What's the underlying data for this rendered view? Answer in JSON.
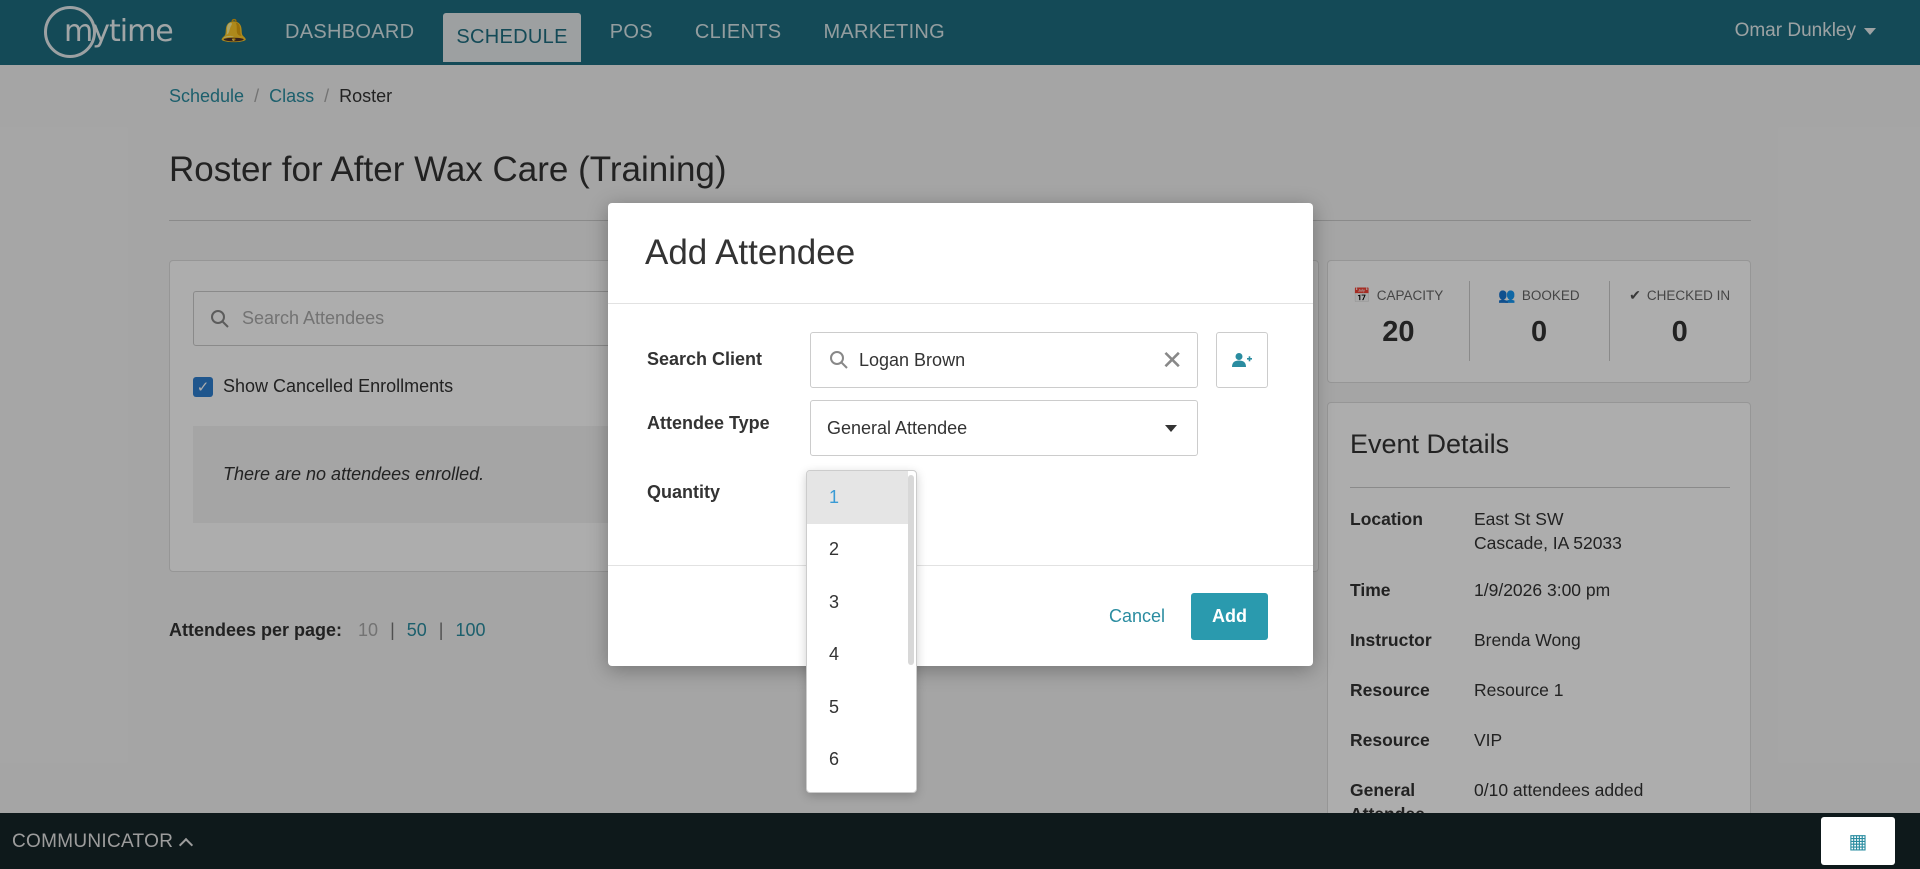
{
  "app": {
    "logo_text": "mytime"
  },
  "nav": {
    "items": [
      {
        "label": "DASHBOARD"
      },
      {
        "label": "SCHEDULE"
      },
      {
        "label": "POS"
      },
      {
        "label": "CLIENTS"
      },
      {
        "label": "MARKETING"
      }
    ],
    "active": "SCHEDULE",
    "user": "Omar Dunkley"
  },
  "breadcrumb": {
    "items": [
      "Schedule",
      "Class",
      "Roster"
    ],
    "separator": "/"
  },
  "page": {
    "title": "Roster for After Wax Care (Training)"
  },
  "roster": {
    "search_placeholder": "Search Attendees",
    "show_cancelled_label": "Show Cancelled Enrollments",
    "show_cancelled_checked": true,
    "empty_message": "There are no attendees enrolled.",
    "per_page_label": "Attendees per page:",
    "per_page_options": [
      "10",
      "50",
      "100"
    ],
    "per_page_current": "10"
  },
  "stats": {
    "capacity_label": "CAPACITY",
    "capacity_value": "20",
    "booked_label": "BOOKED",
    "booked_value": "0",
    "checked_in_label": "CHECKED IN",
    "checked_in_value": "0"
  },
  "event": {
    "title": "Event Details",
    "location_label": "Location",
    "location_line1": "East St SW",
    "location_line2": "Cascade, IA 52033",
    "time_label": "Time",
    "time_value": "1/9/2026 3:00 pm",
    "instructor_label": "Instructor",
    "instructor_value": "Brenda Wong",
    "resource1_label": "Resource",
    "resource1_value": "Resource 1",
    "resource2_label": "Resource",
    "resource2_value": "VIP",
    "limit_label": "General Attendee Limit",
    "limit_value": "0/10 attendees added"
  },
  "modal": {
    "title": "Add Attendee",
    "search_client_label": "Search Client",
    "search_client_value": "Logan Brown",
    "attendee_type_label": "Attendee Type",
    "attendee_type_value": "General Attendee",
    "quantity_label": "Quantity",
    "quantity_options": [
      "1",
      "2",
      "3",
      "4",
      "5",
      "6"
    ],
    "quantity_selected": "1",
    "cancel_label": "Cancel",
    "add_label": "Add"
  },
  "communicator": {
    "label": "COMMUNICATOR"
  },
  "colors": {
    "nav_bg": "#1e6e80",
    "accent": "#2a9aae",
    "link": "#2a8ca0",
    "checkbox": "#2f7fd0",
    "communicator_bg": "#152528"
  }
}
